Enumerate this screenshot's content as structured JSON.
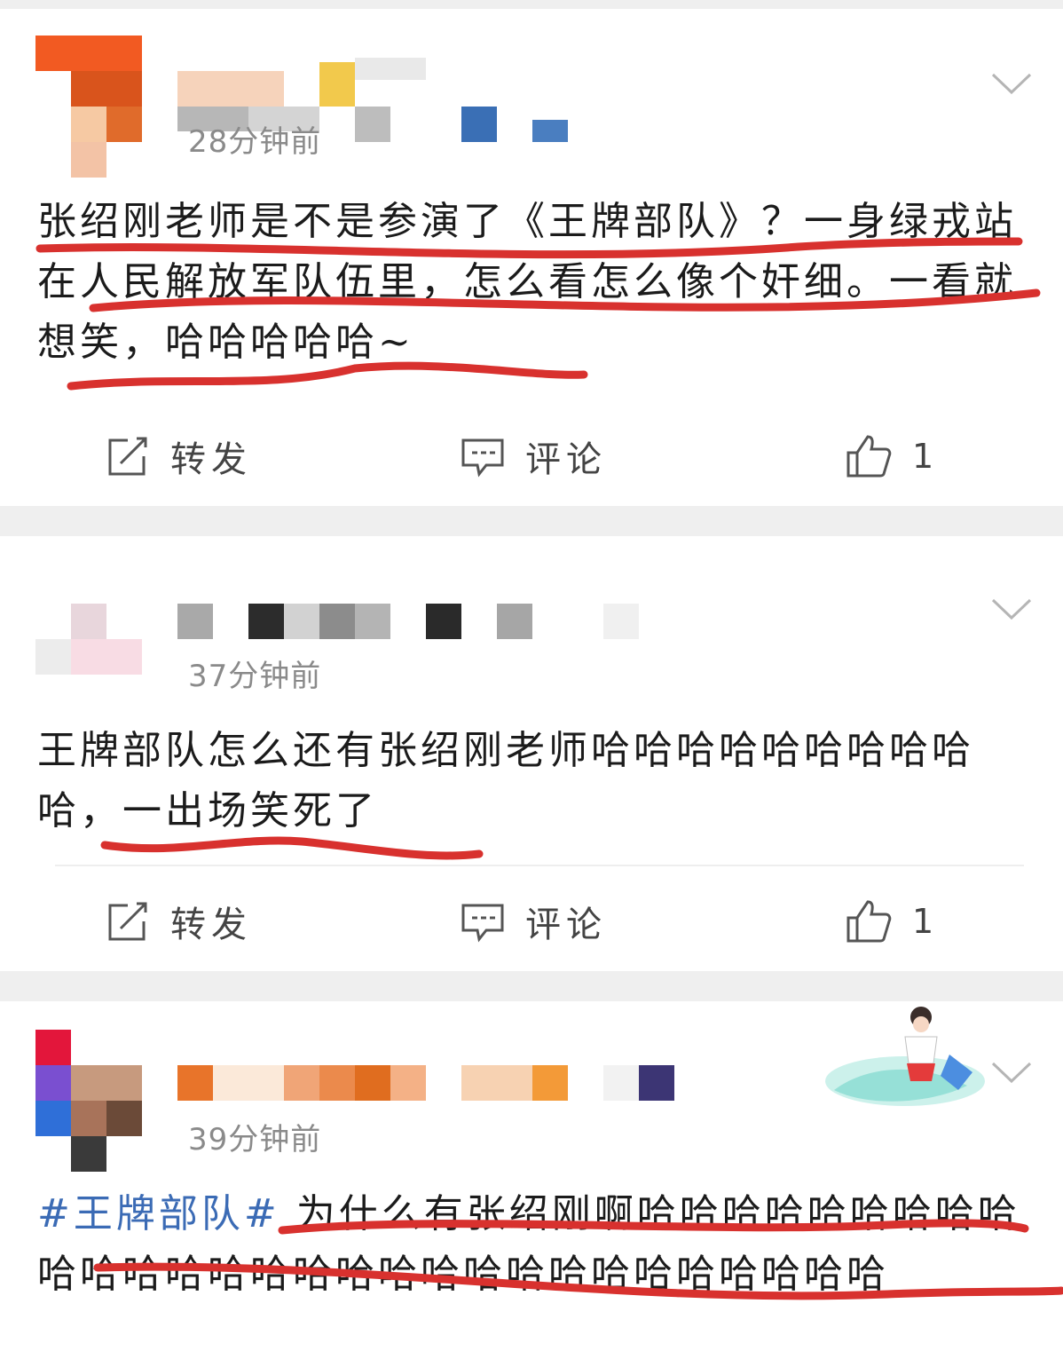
{
  "posts": [
    {
      "time": "28分钟前",
      "content": "张绍刚老师是不是参演了《王牌部队》？一身绿戎站在人民解放军队伍里，怎么看怎么像个奸细。一看就想笑，哈哈哈哈哈~",
      "actions": {
        "repost": "转发",
        "comment": "评论",
        "like_count": "1"
      }
    },
    {
      "time": "37分钟前",
      "content": "王牌部队怎么还有张绍刚老师哈哈哈哈哈哈哈哈哈哈，一出场笑死了",
      "actions": {
        "repost": "转发",
        "comment": "评论",
        "like_count": "1"
      }
    },
    {
      "time": "39分钟前",
      "hashtag": "#王牌部队#",
      "content": " 为什么有张绍刚啊哈哈哈哈哈哈哈哈哈哈哈哈哈哈哈哈哈哈哈哈哈哈哈哈哈哈哈哈哈"
    }
  ],
  "colors": {
    "underline": "#d8312e",
    "hashtag": "#3b6bb5",
    "time": "#8a8a8a",
    "separator": "#efefef"
  },
  "icons": {
    "repost": "edit-share-icon",
    "comment": "comment-bubble-icon",
    "like": "thumbs-up-icon",
    "more": "chevron-down-icon"
  }
}
